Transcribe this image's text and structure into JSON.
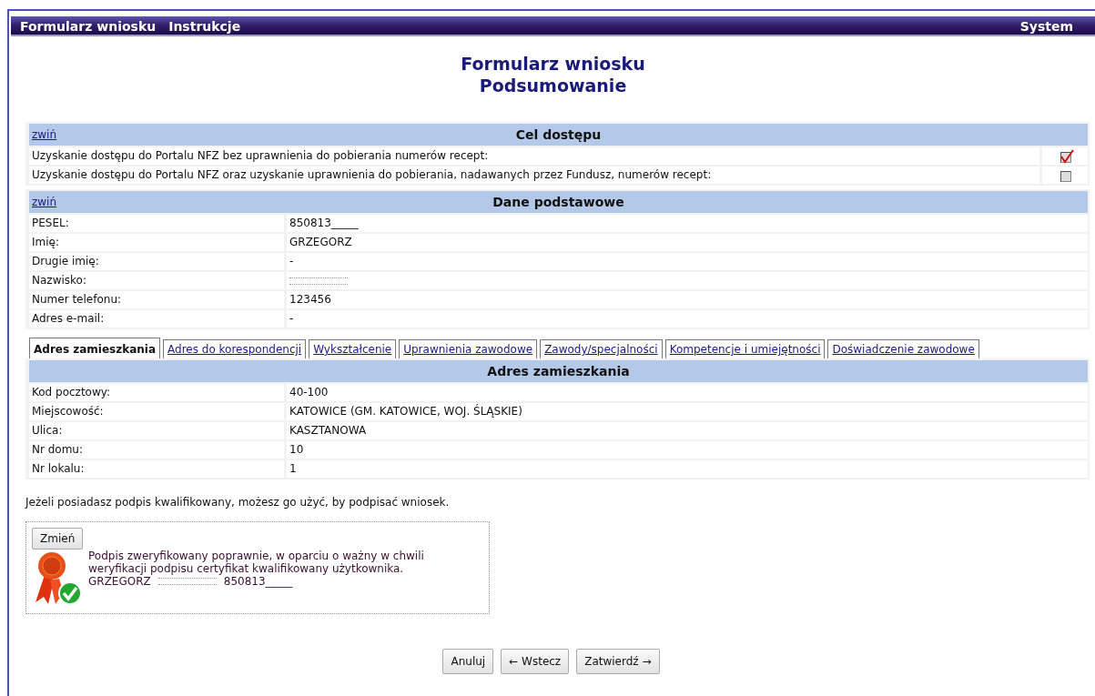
{
  "menu": [
    {
      "label": "Formularz wniosku"
    },
    {
      "label": "Instrukcje"
    }
  ],
  "menu_right": "System",
  "title": [
    "Formularz wniosku",
    "Podsumowanie"
  ],
  "sections": [
    {
      "kind": "checklist",
      "toggle": "zwiń",
      "heading": "Cel dostępu",
      "rows": [
        {
          "label": "Uzyskanie dostępu do Portalu NFZ bez uprawnienia do pobierania numerów recept:",
          "checked": true
        },
        {
          "label": "Uzyskanie dostępu do Portalu NFZ oraz uzyskanie uprawnienia do pobierania, nadawanych przez Fundusz, numerów recept:",
          "checked": false
        }
      ]
    },
    {
      "kind": "fields",
      "toggle": "zwiń",
      "heading": "Dane podstawowe",
      "rows": [
        {
          "label": "PESEL:",
          "value": "850813_____"
        },
        {
          "label": "Imię:",
          "value": "GRZEGORZ"
        },
        {
          "label": "Drugie imię:",
          "value": "-"
        },
        {
          "label": "Nazwisko:",
          "redacted": true
        },
        {
          "label": "Numer telefonu:",
          "value": "123456"
        },
        {
          "label": "Adres e-mail:",
          "value": "-"
        }
      ]
    }
  ],
  "tabs": [
    {
      "label": "Adres zamieszkania",
      "selected": true
    },
    {
      "label": "Adres do korespondencji",
      "selected": false
    },
    {
      "label": "Wykształcenie",
      "selected": false
    },
    {
      "label": "Uprawnienia zawodowe",
      "selected": false
    },
    {
      "label": "Zawody/specjalności",
      "selected": false
    },
    {
      "label": "Kompetencje i umiejętności",
      "selected": false
    },
    {
      "label": "Doświadczenie zawodowe",
      "selected": false
    }
  ],
  "tab_panel": {
    "heading": "Adres zamieszkania",
    "rows": [
      {
        "label": "Kod pocztowy:",
        "value": "40-100"
      },
      {
        "label": "Miejscowość:",
        "value": "KATOWICE (GM. KATOWICE, WOJ. ŚLĄSKIE)"
      },
      {
        "label": "Ulica:",
        "value": "KASZTANOWA"
      },
      {
        "label": "Nr domu:",
        "value": "10"
      },
      {
        "label": "Nr lokalu:",
        "value": "1"
      }
    ]
  },
  "signature_note": "Jeżeli posiadasz podpis kwalifikowany, możesz go użyć, by podpisać wniosek.",
  "signature": {
    "button": "Zmień",
    "verified": true,
    "message": "Podpis zweryfikowany poprawnie, w oparciu o ważny w chwili weryfikacji podpisu certyfikat kwalifikowany użytkownika.",
    "first_name": "GRZEGORZ",
    "surname_redacted": true,
    "pesel": "850813_____"
  },
  "buttons": [
    "Anuluj",
    "← Wstecz",
    "Zatwierdź →"
  ]
}
